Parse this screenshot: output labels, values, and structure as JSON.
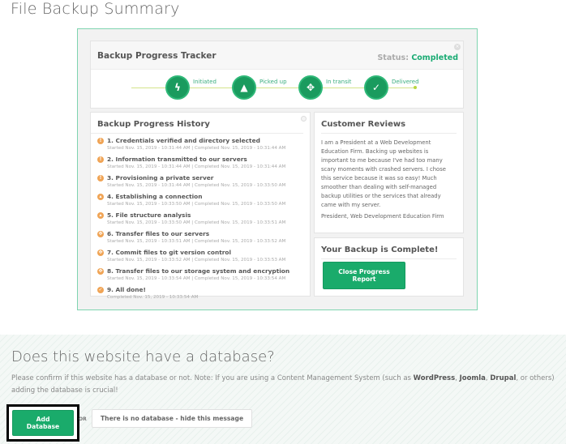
{
  "page": {
    "title": "File Backup Summary"
  },
  "tracker": {
    "title": "Backup Progress Tracker",
    "status_label": "Status:",
    "status_value": "Completed",
    "steps": [
      {
        "label": "Initiated",
        "icon": "lightning-icon",
        "glyph": "ϟ"
      },
      {
        "label": "Picked up",
        "icon": "thumbs-up-icon",
        "glyph": "👍"
      },
      {
        "label": "In transit",
        "icon": "move-arrows-icon",
        "glyph": "✥"
      },
      {
        "label": "Delivered",
        "icon": "check-icon",
        "glyph": "✓"
      }
    ]
  },
  "history": {
    "title": "Backup Progress History",
    "items": [
      {
        "title": "1. Credentials verified and directory selected",
        "meta": "Started Nov. 15, 2019 - 10:31:44 AM | Completed Nov. 15, 2019 - 10:31:44 AM",
        "glyph": "!"
      },
      {
        "title": "2. Information transmitted to our servers",
        "meta": "Started Nov. 15, 2019 - 10:31:44 AM | Completed Nov. 15, 2019 - 10:31:44 AM",
        "glyph": "!"
      },
      {
        "title": "3. Provisioning a private server",
        "meta": "Started Nov. 15, 2019 - 10:31:44 AM | Completed Nov. 15, 2019 - 10:33:50 AM",
        "glyph": "!"
      },
      {
        "title": "4. Establishing a connection",
        "meta": "Started Nov. 15, 2019 - 10:33:50 AM | Completed Nov. 15, 2019 - 10:33:50 AM",
        "glyph": "▴"
      },
      {
        "title": "5. File structure analysis",
        "meta": "Started Nov. 15, 2019 - 10:33:50 AM | Completed Nov. 15, 2019 - 10:33:51 AM",
        "glyph": "▴"
      },
      {
        "title": "6. Transfer files to our servers",
        "meta": "Started Nov. 15, 2019 - 10:33:51 AM | Completed Nov. 15, 2019 - 10:33:52 AM",
        "glyph": "✥"
      },
      {
        "title": "7. Commit files to git version control",
        "meta": "Started Nov. 15, 2019 - 10:33:52 AM | Completed Nov. 15, 2019 - 10:33:53 AM",
        "glyph": "✥"
      },
      {
        "title": "8. Transfer files to our storage system and encryption",
        "meta": "Started Nov. 15, 2019 - 10:33:54 AM | Completed Nov. 15, 2019 - 10:33:54 AM",
        "glyph": "✥"
      },
      {
        "title": "9. All done!",
        "meta": "Completed Nov. 15, 2019 - 10:33:54 AM",
        "glyph": "✓"
      }
    ]
  },
  "reviews": {
    "title": "Customer Reviews",
    "text": "I am a President at a Web Development Education Firm. Backing up websites is important to me because I've had too many scary moments with crashed servers. I chose this service because it was so easy! Much smoother than dealing with self-managed backup utilities or the services that already came with my server.",
    "author": "President, Web Development Education Firm"
  },
  "complete": {
    "title": "Your Backup is Complete!",
    "button_label": "Close Progress Report"
  },
  "database": {
    "title": "Does this website have a database?",
    "text_before": "Please confirm if this website has a database or not. Note: If you are using a Content Management System (such as ",
    "cms1": "WordPress",
    "sep1": ", ",
    "cms2": "Joomla",
    "sep2": ", ",
    "cms3": "Drupal",
    "text_after": ", or others) adding the database is crucial!",
    "add_button": "Add Database",
    "or_label": "OR",
    "hide_button": "There is no database - hide this message"
  },
  "colors": {
    "accent": "#1aab6b",
    "warning": "#f0a455",
    "frame_border": "#7fd4b0"
  }
}
